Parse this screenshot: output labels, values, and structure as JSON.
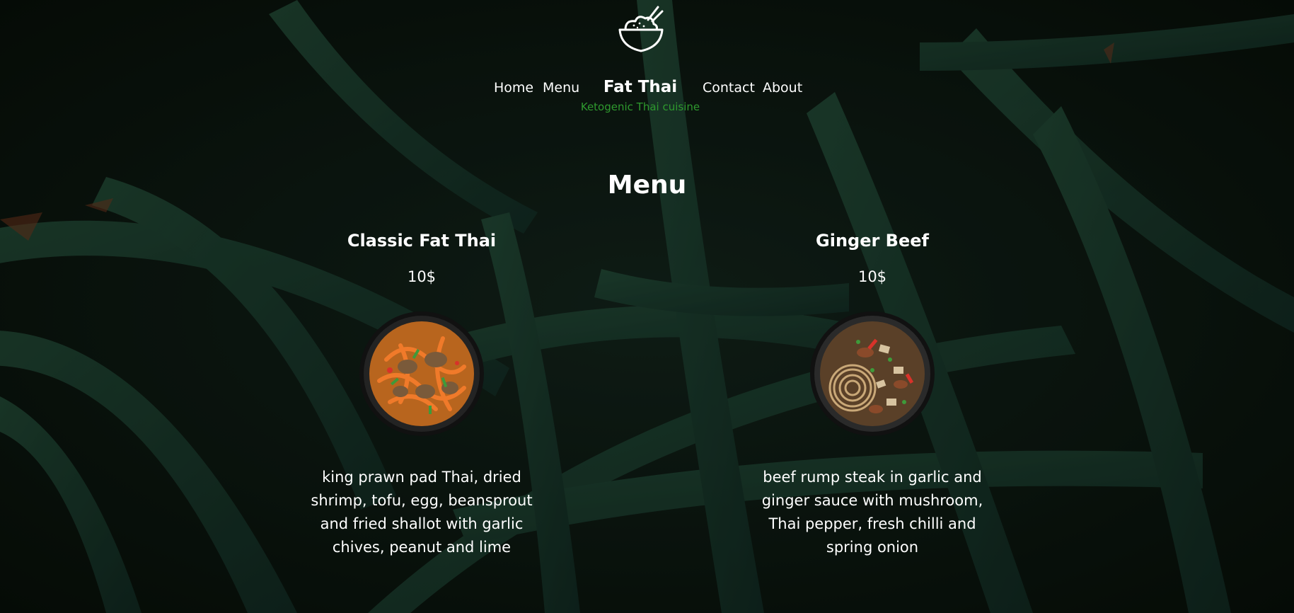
{
  "header": {
    "logo_icon": "rice-bowl-icon",
    "nav": {
      "home": "Home",
      "menu": "Menu",
      "contact": "Contact",
      "about": "About"
    },
    "brand": {
      "name": "Fat Thai",
      "tagline": "Ketogenic Thai cuisine"
    }
  },
  "main": {
    "title": "Menu",
    "items": [
      {
        "name": "Classic Fat Thai",
        "price": "10$",
        "description": "king prawn pad Thai, dried shrimp, tofu, egg, beansprout and fried shallot with garlic chives, peanut and lime",
        "image_icon": "pad-thai-bowl-image"
      },
      {
        "name": "Ginger Beef",
        "price": "10$",
        "description": "beef rump steak in garlic and ginger sauce with mushroom, Thai pepper, fresh chilli and spring onion",
        "image_icon": "ginger-beef-bowl-image"
      }
    ]
  },
  "colors": {
    "background": "#0d1a14",
    "leaf": "#1f4a36",
    "text": "#ffffff",
    "tagline": "#2e9a2e"
  }
}
